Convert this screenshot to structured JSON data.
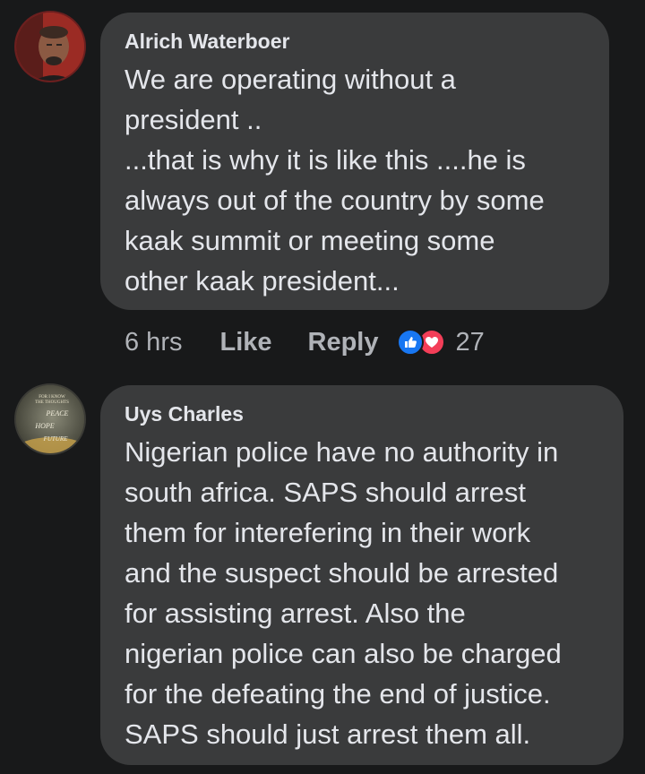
{
  "comments": [
    {
      "author": "Alrich Waterboer",
      "text": "We are operating without a\npresident ..\n...that is why it is like this ....he is\nalways out of the country by some\nkaak summit or meeting some\nother kaak president...",
      "time": "6 hrs",
      "like_label": "Like",
      "reply_label": "Reply",
      "reaction_count": "27",
      "reactions": [
        "like-icon",
        "love-icon"
      ]
    },
    {
      "author": "Uys Charles",
      "text": "Nigerian police have no authority in\nsouth africa.  SAPS should arrest\nthem for  interefering  in their work\nand the suspect should be arrested\nfor assisting arrest. Also the\nnigerian police can also be charged\nfor the defeating the end of justice.\nSAPS should just arrest them all.",
      "avatar_text": [
        "FOR I KNOW",
        "THE THOUGHTS",
        "PEACE",
        "HOPE",
        "FUTURE"
      ]
    }
  ],
  "colors": {
    "background": "#18191a",
    "bubble": "#3a3b3c",
    "text": "#e4e6eb",
    "secondary": "#b0b3b8",
    "like_blue": "#1877f2",
    "love_red": "#f33e58"
  }
}
